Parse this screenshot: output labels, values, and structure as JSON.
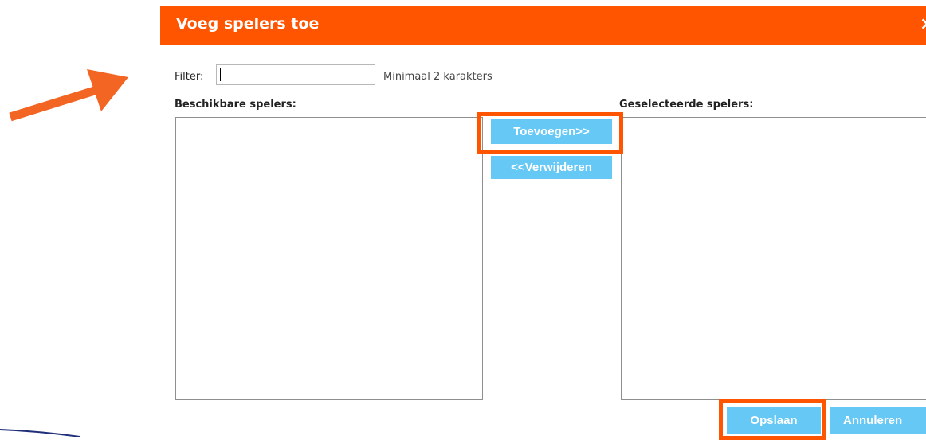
{
  "dialog": {
    "title": "Voeg spelers toe",
    "close_glyph": "×"
  },
  "filter": {
    "label": "Filter:",
    "value": "",
    "hint": "Minimaal 2 karakters"
  },
  "available": {
    "label": "Beschikbare spelers:",
    "items": []
  },
  "selected": {
    "label": "Geselecteerde spelers:",
    "items": []
  },
  "buttons": {
    "add": "Toevoegen>>",
    "remove": "<<Verwijderen",
    "save": "Opslaan",
    "cancel": "Annuleren"
  },
  "colors": {
    "header": "#ff5500",
    "button": "#66c8f5",
    "highlight": "#ff5500",
    "arrow": "#f26522",
    "line": "#1f2f7a"
  }
}
